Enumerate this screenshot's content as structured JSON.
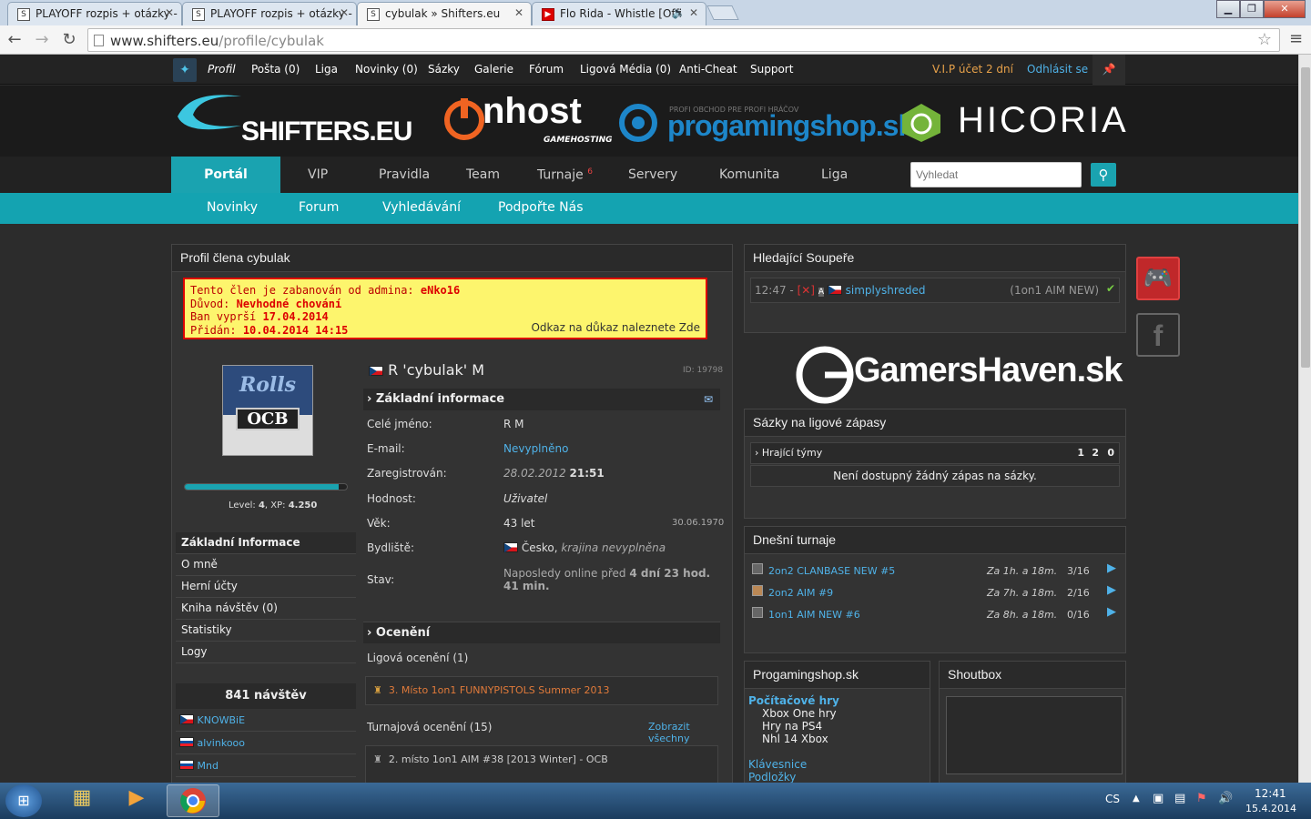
{
  "browser": {
    "tabs": [
      {
        "title": "PLAYOFF rozpis + otázky -",
        "active": false
      },
      {
        "title": "PLAYOFF rozpis + otázky -",
        "active": false
      },
      {
        "title": "cybulak » Shifters.eu",
        "active": true
      },
      {
        "title": "Flo Rida - Whistle [Offi",
        "active": false
      }
    ],
    "url_host": "www.shifters.eu",
    "url_path": "/profile/cybulak"
  },
  "topnav": {
    "items": [
      "Profil",
      "Pošta (0)",
      "Liga",
      "Novinky (0)",
      "Sázky",
      "Galerie",
      "Fórum",
      "Ligová Média (0)",
      "Anti-Cheat",
      "Support"
    ],
    "vip": "V.I.P účet  2 dní",
    "logout": "Odhlásit se"
  },
  "banner": {
    "logo_text": "SHIFTERS.EU",
    "sponsor1": "nhost",
    "sponsor1_sub": "GAMEHOSTING",
    "sponsor2": "progamingshop.sk",
    "sponsor2_sub": "PROFI OBCHOD PRE PROFI HRÁČOV",
    "sponsor3": "HICORIA"
  },
  "mainnav": {
    "active": "Portál",
    "items": [
      "VIP",
      "Pravidla",
      "Team",
      "Turnaje",
      "Servery",
      "Komunita",
      "Liga"
    ],
    "turnaje_badge": "6",
    "search_placeholder": "Vyhledat"
  },
  "subnav": [
    "Novinky",
    "Forum",
    "Vyhledávání",
    "Podpořte Nás"
  ],
  "profile": {
    "panel_title": "Profil člena cybulak",
    "ban": {
      "line1_label": "Tento člen je zabanován od admina:",
      "line1_value": "eNko16",
      "line2_label": "Důvod:",
      "line2_value": "Nevhodné chování",
      "line3_label": "Ban vyprší",
      "line3_value": "17.04.2014",
      "line4_label": "Přidán:",
      "line4_value": "10.04.2014 14:15",
      "proof": "Odkaz na důkaz naleznete Zde"
    },
    "name": "R 'cybulak' M",
    "id": "ID: 19798",
    "level_label": "Level:",
    "level": "4",
    "xp_label": "XP:",
    "xp": "4.250",
    "xp_fraction": 0.95,
    "menu": [
      "Základní Informace",
      "O mně",
      "Herní účty",
      "Kniha návštěv (0)",
      "Statistiky",
      "Logy"
    ],
    "visits": "841 návštěv",
    "visitors": [
      "KNOWBiE",
      "alvinkooo",
      "Mnd"
    ],
    "basic_header": "Základní informace",
    "fields": [
      {
        "label": "Celé jméno:",
        "value": "R M"
      },
      {
        "label": "E-mail:",
        "value": "Nevyplněno"
      },
      {
        "label": "Zaregistrován:",
        "value": "28.02.2012",
        "value_bold": "21:51"
      },
      {
        "label": "Hodnost:",
        "value": "Uživatel"
      },
      {
        "label": "Věk:",
        "value": "43 let",
        "extra": "30.06.1970"
      },
      {
        "label": "Bydliště:",
        "value": "Česko,",
        "value_italic": "krajina nevyplněna"
      },
      {
        "label": "Stav:",
        "value": "Naposledy online před",
        "value_bold": "4 dní 23 hod. 41 min."
      }
    ],
    "awards_header": "Ocenění",
    "league_awards": "Ligová ocenění (1)",
    "league_award_1": "3. Místo 1on1 FUNNYPISTOLS Summer 2013",
    "tourn_awards": "Turnajová ocenění (15)",
    "show_all": "Zobrazit všechny",
    "tourn_award_1": "2. místo 1on1 AIM #38 [2013 Winter] - OCB"
  },
  "opponents": {
    "title": "Hledající Soupeře",
    "time": "12:47 -",
    "player": "simplyshreded",
    "mode": "(1on1 AIM NEW)"
  },
  "gamershaven": "GamersHaven.sk",
  "bets": {
    "title": "Sázky na ligové zápasy",
    "header": "Hrající týmy",
    "cols": [
      "1",
      "2",
      "0"
    ],
    "empty": "Není dostupný žádný zápas na sázky."
  },
  "tournaments": {
    "title": "Dnešní turnaje",
    "items": [
      {
        "name": "2on2 CLANBASE NEW #5",
        "time": "Za 1h. a 18m.",
        "count": "3/16"
      },
      {
        "name": "2on2 AIM #9",
        "time": "Za 7h. a 18m.",
        "count": "2/16"
      },
      {
        "name": "1on1 AIM NEW #6",
        "time": "Za 8h. a 18m.",
        "count": "0/16"
      }
    ]
  },
  "shop": {
    "title": "Progamingshop.sk",
    "category": "Počítačové hry",
    "items": [
      "Xbox One hry",
      "Hry na PS4",
      "Nhl 14 Xbox"
    ],
    "links": [
      "Klávesnice",
      "Podložky"
    ]
  },
  "shoutbox": {
    "title": "Shoutbox"
  },
  "taskbar": {
    "lang": "CS",
    "time": "12:41",
    "date": "15.4.2014"
  },
  "colors": {
    "accent": "#1aa3b0",
    "link": "#4fb2e8",
    "ban_bg": "#fdf56d",
    "ban_border": "#dd0000"
  }
}
